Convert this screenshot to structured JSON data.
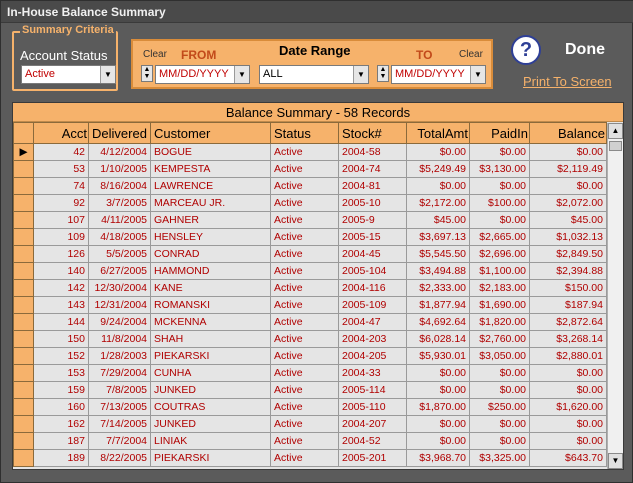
{
  "window": {
    "title": "In-House Balance Summary"
  },
  "criteria": {
    "legend": "Summary Criteria",
    "account_status_label": "Account Status",
    "account_status_value": "Active"
  },
  "date_range": {
    "title": "Date Range",
    "clear_left": "Clear",
    "clear_right": "Clear",
    "from_label": "FROM",
    "to_label": "TO",
    "from_placeholder": "MM/DD/YYYY",
    "to_placeholder": "MM/DD/YYYY",
    "range_value": "ALL"
  },
  "actions": {
    "done": "Done",
    "print": "Print To Screen",
    "help_glyph": "?"
  },
  "grid": {
    "title": "Balance Summary - 58 Records",
    "columns": [
      "Acct",
      "Delivered",
      "Customer",
      "Status",
      "Stock#",
      "TotalAmt",
      "PaidIn",
      "Balance"
    ],
    "rows": [
      [
        "42",
        "4/12/2004",
        "BOGUE",
        "Active",
        "2004-58",
        "$0.00",
        "$0.00",
        "$0.00"
      ],
      [
        "53",
        "1/10/2005",
        "KEMPESTA",
        "Active",
        "2004-74",
        "$5,249.49",
        "$3,130.00",
        "$2,119.49"
      ],
      [
        "74",
        "8/16/2004",
        "LAWRENCE",
        "Active",
        "2004-81",
        "$0.00",
        "$0.00",
        "$0.00"
      ],
      [
        "92",
        "3/7/2005",
        "MARCEAU JR.",
        "Active",
        "2005-10",
        "$2,172.00",
        "$100.00",
        "$2,072.00"
      ],
      [
        "107",
        "4/11/2005",
        "GAHNER",
        "Active",
        "2005-9",
        "$45.00",
        "$0.00",
        "$45.00"
      ],
      [
        "109",
        "4/18/2005",
        "HENSLEY",
        "Active",
        "2005-15",
        "$3,697.13",
        "$2,665.00",
        "$1,032.13"
      ],
      [
        "126",
        "5/5/2005",
        "CONRAD",
        "Active",
        "2004-45",
        "$5,545.50",
        "$2,696.00",
        "$2,849.50"
      ],
      [
        "140",
        "6/27/2005",
        "HAMMOND",
        "Active",
        "2005-104",
        "$3,494.88",
        "$1,100.00",
        "$2,394.88"
      ],
      [
        "142",
        "12/30/2004",
        "KANE",
        "Active",
        "2004-116",
        "$2,333.00",
        "$2,183.00",
        "$150.00"
      ],
      [
        "143",
        "12/31/2004",
        "ROMANSKI",
        "Active",
        "2005-109",
        "$1,877.94",
        "$1,690.00",
        "$187.94"
      ],
      [
        "144",
        "9/24/2004",
        "MCKENNA",
        "Active",
        "2004-47",
        "$4,692.64",
        "$1,820.00",
        "$2,872.64"
      ],
      [
        "150",
        "11/8/2004",
        "SHAH",
        "Active",
        "2004-203",
        "$6,028.14",
        "$2,760.00",
        "$3,268.14"
      ],
      [
        "152",
        "1/28/2003",
        "PIEKARSKI",
        "Active",
        "2004-205",
        "$5,930.01",
        "$3,050.00",
        "$2,880.01"
      ],
      [
        "153",
        "7/29/2004",
        "CUNHA",
        "Active",
        "2004-33",
        "$0.00",
        "$0.00",
        "$0.00"
      ],
      [
        "159",
        "7/8/2005",
        "JUNKED",
        "Active",
        "2005-114",
        "$0.00",
        "$0.00",
        "$0.00"
      ],
      [
        "160",
        "7/13/2005",
        "COUTRAS",
        "Active",
        "2005-110",
        "$1,870.00",
        "$250.00",
        "$1,620.00"
      ],
      [
        "162",
        "7/14/2005",
        "JUNKED",
        "Active",
        "2004-207",
        "$0.00",
        "$0.00",
        "$0.00"
      ],
      [
        "187",
        "7/7/2004",
        "LINIAK",
        "Active",
        "2004-52",
        "$0.00",
        "$0.00",
        "$0.00"
      ],
      [
        "189",
        "8/22/2005",
        "PIEKARSKI",
        "Active",
        "2005-201",
        "$3,968.70",
        "$3,325.00",
        "$643.70"
      ]
    ]
  }
}
